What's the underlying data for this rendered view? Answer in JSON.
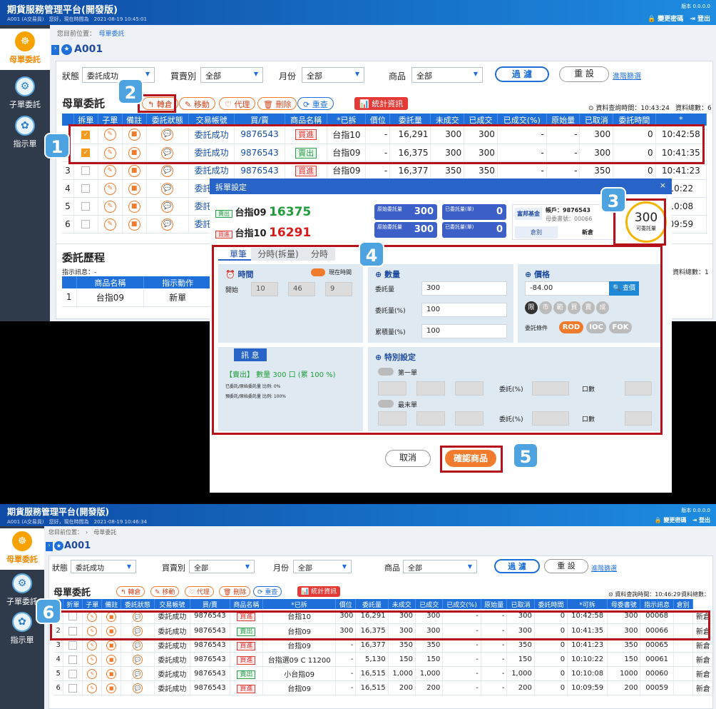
{
  "top": {
    "header": {
      "title": "期貨服務管理平台(開發版)",
      "sub": "A001 (A交易員)　您好，現在時間為　2021-08-19 10:45:01",
      "version": "版本 0.0.0.0",
      "change_pwd": "🔒 變更密碼",
      "logout": "⇥ 登出"
    },
    "sidebar": [
      {
        "label": "母單委託",
        "icon": "☸"
      },
      {
        "label": "子單委託",
        "icon": "⚙"
      },
      {
        "label": "指示單",
        "icon": "✿"
      }
    ],
    "breadcrumb": {
      "prefix": "您目前位置：",
      "current": "母單委託"
    },
    "account": "A001",
    "filters": {
      "status_label": "狀態",
      "status": "委託成功",
      "side_label": "買賣別",
      "side": "全部",
      "month_label": "月份",
      "month": "全部",
      "product_label": "商品",
      "product": "全部",
      "filter_btn": "過 濾",
      "reset_btn": "重 設",
      "advanced": "進階篩選"
    },
    "section_title": "母單委託",
    "toolbar": {
      "transfer": "↰ 轉倉",
      "move": "✎ 移動",
      "agent": "♡ 代理",
      "delete": "🗑 刪除",
      "reload": "⟳ 重查",
      "stats": "📊 統計資訊"
    },
    "query_time": "⊙ 資料查詢時間：10:43:24",
    "total": "資料總數：6",
    "columns": [
      "",
      "拆單",
      "子單",
      "備註",
      "委託狀態",
      "交易帳號",
      "買/賣",
      "商品名稱",
      "*已拆",
      "價位",
      "委託量",
      "未成交",
      "已成交",
      "已成交(%)",
      "原始量",
      "已取消",
      "委託時間",
      "*"
    ],
    "rows": [
      {
        "n": "",
        "cb": true,
        "status": "委託成功",
        "acct": "9876543",
        "side": "買進",
        "prod": "台指10",
        "split": "-",
        "price": "16,291",
        "qty": "300",
        "open": "300",
        "done": "-",
        "pct": "-",
        "orig": "300",
        "cancel": "0",
        "time": "10:42:58"
      },
      {
        "n": "",
        "cb": true,
        "status": "委託成功",
        "acct": "9876543",
        "side": "賣出",
        "prod": "台指09",
        "split": "-",
        "price": "16,375",
        "qty": "300",
        "open": "300",
        "done": "-",
        "pct": "-",
        "orig": "300",
        "cancel": "0",
        "time": "10:41:35"
      },
      {
        "n": "3",
        "cb": false,
        "status": "委託成功",
        "acct": "9876543",
        "side": "買進",
        "prod": "台指09",
        "split": "-",
        "price": "16,377",
        "qty": "350",
        "open": "350",
        "done": "-",
        "pct": "-",
        "orig": "350",
        "cancel": "0",
        "time": "10:41:23"
      },
      {
        "n": "4",
        "cb": false,
        "status": "委託成功",
        "acct": "9876543",
        "side": "買進",
        "prod": "",
        "split": "",
        "price": "",
        "qty": "",
        "open": "",
        "done": "",
        "pct": "",
        "orig": "",
        "cancel": "",
        "time": "10:22"
      },
      {
        "n": "5",
        "cb": false,
        "status": "委託成功",
        "acct": "9876543",
        "side": "賣出",
        "prod": "",
        "split": "",
        "price": "",
        "qty": "",
        "open": "",
        "done": "",
        "pct": "",
        "orig": "",
        "cancel": "",
        "time": "10:08"
      },
      {
        "n": "6",
        "cb": false,
        "status": "委託成功",
        "acct": "9876543",
        "side": "買進",
        "prod": "",
        "split": "",
        "price": "",
        "qty": "",
        "open": "",
        "done": "",
        "pct": "",
        "orig": "",
        "cancel": "",
        "time": "09:59"
      }
    ],
    "history": {
      "title": "委託歷程",
      "info": "指示訊息：-",
      "col1": "商品名稱",
      "col2": "指示動作",
      "row_n": "1",
      "row_prod": "台指09",
      "row_act": "新單",
      "total": "資料總數：1"
    }
  },
  "dialog": {
    "title": "拆單設定",
    "close": "×",
    "sell_tag": "賣出",
    "sell_prod": "台指09",
    "sell_price": "16375",
    "buy_tag": "買進",
    "buy_prod": "台指10",
    "buy_price": "16291",
    "orig_label": "原始委託量",
    "orig1": "300",
    "orig2": "300",
    "done_label": "已委託量(單)",
    "done1": "0",
    "done2": "0",
    "fund": "富邦基金",
    "acct_line": "帳戶：9876543",
    "order_line": "母委書號：00066",
    "kind_label": "倉別",
    "kind": "新倉",
    "avail": "300",
    "avail_label": "可委託量",
    "tabs": [
      "單筆",
      "分時(拆量)",
      "分時"
    ],
    "time": {
      "title": "⏰ 時間",
      "now_label": "現在時間",
      "start": "開始",
      "h": "10",
      "m": "46",
      "s": "9"
    },
    "qty": {
      "title": "⊕ 數量",
      "q_label": "委託量",
      "q": "300",
      "pct_label": "委託量(%)",
      "pct": "100",
      "acc_label": "累積量(%)",
      "acc": "100"
    },
    "price": {
      "title": "⊕ 價格",
      "value": "-84.00",
      "query": "🔍 查價",
      "types": [
        "限",
        "市",
        "範",
        "買",
        "賣",
        "成"
      ],
      "cond_label": "委託條件",
      "rod": "ROD",
      "ioc": "IOC",
      "fok": "FOK"
    },
    "msg": {
      "title": "訊 息",
      "line": "【賣出】 數量 300 口 (累 100 %)",
      "l2": "已委託/原始委託量 比例: 0%",
      "l3": "預委託/原始委託量 比例: 100%"
    },
    "special": {
      "title": "⊕ 特別設定",
      "first": "第一單",
      "last": "最末單",
      "pct": "委託(%)",
      "lots": "口數"
    },
    "cancel": "取消",
    "confirm": "確認商品"
  },
  "bottom": {
    "header": {
      "title": "期貨服務管理平台(開發版)",
      "sub": "A001 (A交易員)　您好，現在時間為　2021-08-19 10:46:34",
      "version": "版本 0.0.0.0",
      "change_pwd": "🔒 變更密碼",
      "logout": "⇥ 登出"
    },
    "breadcrumb": "您目前位置：　›　母單委託",
    "query_time": "⊙ 資料查詢時間：10:46:29",
    "columns": [
      "",
      "折單",
      "子單",
      "備註",
      "委託狀態",
      "交易帳號",
      "買/賣",
      "商品名稱",
      "*已拆",
      "價位",
      "委託量",
      "未成交",
      "已成交",
      "已成交(%)",
      "原始量",
      "已取消",
      "委託時間",
      "*可拆",
      "母委書號",
      "指示訊息",
      "倉別"
    ],
    "rows": [
      {
        "n": "1",
        "status": "委託成功",
        "acct": "9876543",
        "side": "買進",
        "prod": "台指10",
        "split": "300",
        "price": "16,291",
        "qty": "300",
        "open": "300",
        "done": "-",
        "pct": "-",
        "orig": "300",
        "cancel": "0",
        "time": "10:42:58",
        "can": "300",
        "no": "00068",
        "kind": "新倉"
      },
      {
        "n": "2",
        "status": "委託成功",
        "acct": "9876543",
        "side": "賣出",
        "prod": "台指09",
        "split": "300",
        "price": "16,375",
        "qty": "300",
        "open": "300",
        "done": "-",
        "pct": "-",
        "orig": "300",
        "cancel": "0",
        "time": "10:41:35",
        "can": "300",
        "no": "00066",
        "kind": "新倉"
      },
      {
        "n": "3",
        "status": "委託成功",
        "acct": "9876543",
        "side": "買進",
        "prod": "台指09",
        "split": "-",
        "price": "16,377",
        "qty": "350",
        "open": "350",
        "done": "-",
        "pct": "-",
        "orig": "350",
        "cancel": "0",
        "time": "10:41:23",
        "can": "350",
        "no": "00065",
        "kind": "新倉"
      },
      {
        "n": "4",
        "status": "委託成功",
        "acct": "9876543",
        "side": "買進",
        "prod": "台指選09 C 11200",
        "split": "-",
        "price": "5,130",
        "qty": "150",
        "open": "150",
        "done": "-",
        "pct": "-",
        "orig": "150",
        "cancel": "0",
        "time": "10:10:22",
        "can": "150",
        "no": "00061",
        "kind": "新倉"
      },
      {
        "n": "5",
        "status": "委託成功",
        "acct": "9876543",
        "side": "賣出",
        "prod": "小台指09",
        "split": "-",
        "price": "16,515",
        "qty": "1,000",
        "open": "1,000",
        "done": "-",
        "pct": "-",
        "orig": "1,000",
        "cancel": "0",
        "time": "10:10:08",
        "can": "1000",
        "no": "00060",
        "kind": "新倉"
      },
      {
        "n": "6",
        "status": "委託成功",
        "acct": "9876543",
        "side": "買進",
        "prod": "台指09",
        "split": "-",
        "price": "16,515",
        "qty": "200",
        "open": "200",
        "done": "-",
        "pct": "-",
        "orig": "200",
        "cancel": "0",
        "time": "10:09:59",
        "can": "200",
        "no": "00059",
        "kind": "新倉"
      }
    ]
  },
  "steps": [
    "1",
    "2",
    "3",
    "4",
    "5",
    "6"
  ]
}
